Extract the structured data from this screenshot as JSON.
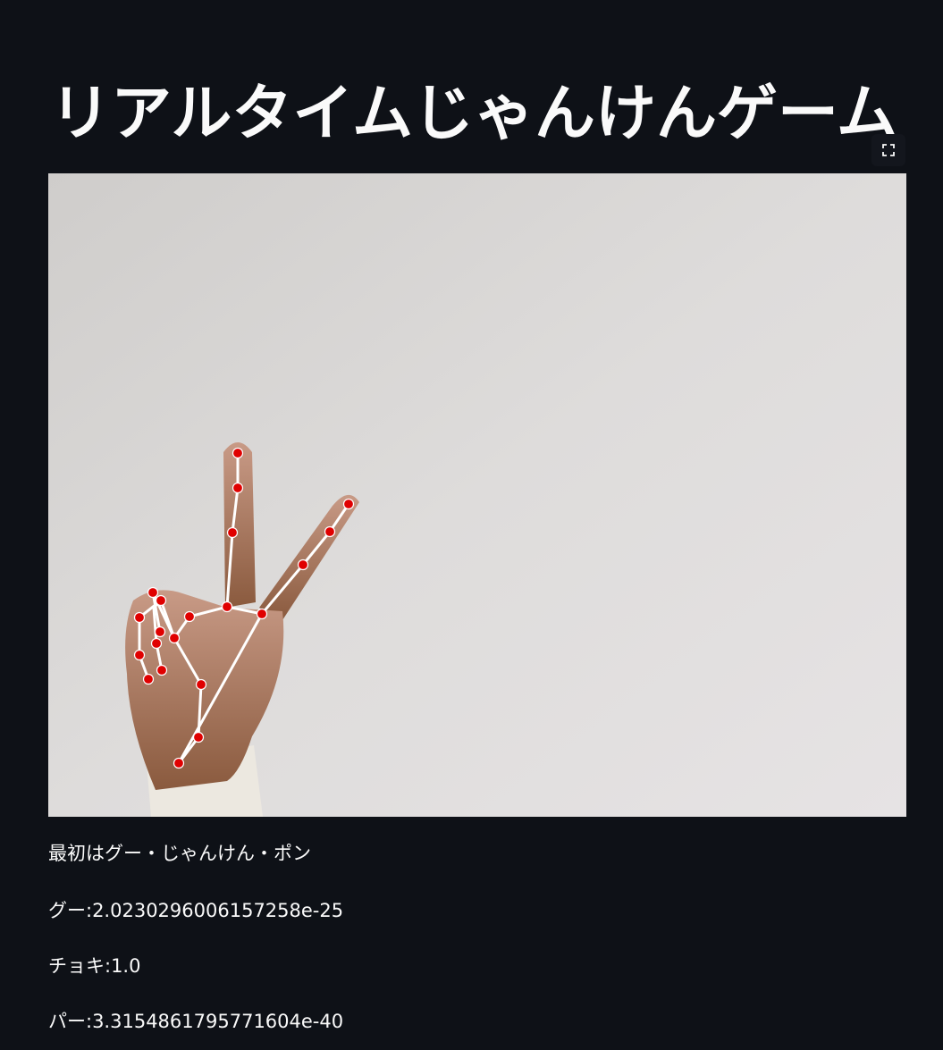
{
  "app": {
    "title": "リアルタイムじゃんけんゲーム"
  },
  "toolbar": {
    "fullscreen_icon": "fullscreen-expand-icon"
  },
  "camera": {
    "content": "webcam frame showing a hand making a peace sign with red landmark points and white skeleton lines",
    "landmark_color": "#e00000",
    "skeleton_color": "#ffffff"
  },
  "status": {
    "instruction": "最初はグー・じゃんけん・ポン",
    "gu": "グー:2.0230296006157258e-25",
    "choki": "チョキ:1.0",
    "pa": "パー:3.3154861795771604e-40"
  },
  "colors": {
    "background": "#0e1117",
    "text": "#fafafa"
  }
}
